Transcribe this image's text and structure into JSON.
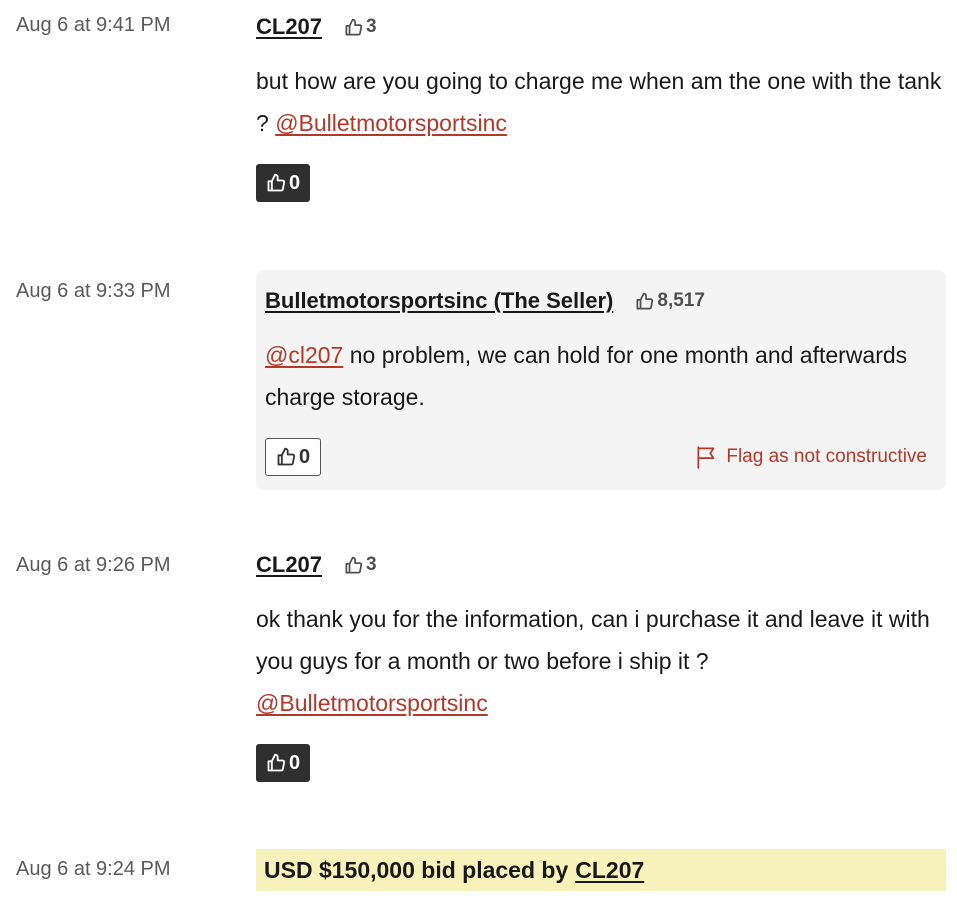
{
  "comments": [
    {
      "time": "Aug 6 at 9:41 PM",
      "user": "CL207",
      "reputation": "3",
      "text": "but how are you going to charge me when am the one with the tank ?",
      "mention": "@Bulletmotorsportsinc",
      "likes": "0",
      "like_style": "dark"
    },
    {
      "time": "Aug 6 at 9:33 PM",
      "user": "Bulletmotorsportsinc (The Seller)",
      "reputation": "8,517",
      "mention": "@cl207",
      "text": "no problem, we can hold for one month and afterwards charge storage.",
      "likes": "0",
      "like_style": "light",
      "flag_label": "Flag as not constructive"
    },
    {
      "time": "Aug 6 at 9:26 PM",
      "user": "CL207",
      "reputation": "3",
      "text": "ok thank you for the information, can i purchase it and leave it with you guys for a month or two before i ship it ?",
      "mention": "@Bulletmotorsportsinc",
      "likes": "0",
      "like_style": "dark"
    }
  ],
  "bid": {
    "time": "Aug 6 at 9:24 PM",
    "text": "USD $150,000 bid placed by",
    "user": "CL207",
    "highlight_color": "#f7f1bb"
  },
  "colors": {
    "mention": "#b3382c",
    "seller_background": "#f4f4f4",
    "dark_button": "#2f2f2f"
  },
  "icons": {
    "reputation": "thumbs-up-icon",
    "like": "thumbs-up-icon",
    "flag": "flag-icon"
  }
}
